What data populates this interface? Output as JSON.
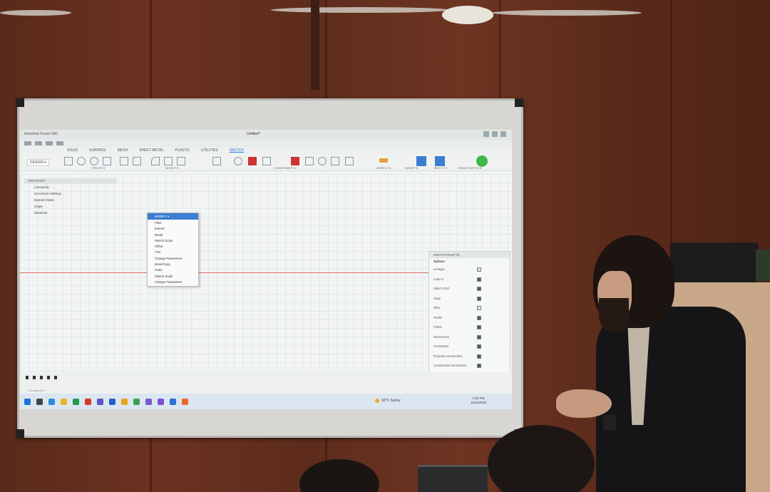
{
  "scene": {
    "description_tag": "classroom-presentation",
    "whiteboard_projection": {
      "app_title": "Autodesk Fusion 360",
      "document_title": "Untitled*",
      "ribbon_tabs": [
        "SOLID",
        "SURFACE",
        "MESH",
        "SHEET METAL",
        "PLASTIC",
        "UTILITIES",
        "SKETCH"
      ],
      "active_tab": "SKETCH",
      "design_dropdown": "DESIGN ▾",
      "groups": [
        "CREATE ▾",
        "MODIFY ▾",
        "CONSTRAINTS ▾",
        "INSPECT ▾",
        "INSERT ▾",
        "SELECT ▾",
        "FINISH SKETCH ▾"
      ],
      "browser": {
        "header": "BROWSER",
        "items": [
          "(Unsaved)",
          "Document Settings",
          "Named Views",
          "Origin",
          "Sketches"
        ]
      },
      "context_menu": {
        "title": "MODIFY ▾",
        "items": [
          "Fillet",
          "Extend",
          "Break",
          "Sketch Scale",
          "Offset",
          "Trim",
          "Change Parameters",
          "Move/Copy",
          "Scale",
          "Sketch Scale",
          "Change Parameters"
        ]
      },
      "sketch_palette": {
        "header": "SKETCH PALETTE",
        "section": "Options",
        "options": [
          {
            "label": "Linetype",
            "on": false
          },
          {
            "label": "Look At",
            "on": true
          },
          {
            "label": "Sketch Grid",
            "on": true
          },
          {
            "label": "Snap",
            "on": true
          },
          {
            "label": "Slice",
            "on": false
          },
          {
            "label": "Profile",
            "on": true
          },
          {
            "label": "Points",
            "on": true
          },
          {
            "label": "Dimensions",
            "on": true
          },
          {
            "label": "Constraints",
            "on": true
          },
          {
            "label": "Projected Geometries",
            "on": true
          },
          {
            "label": "Construction Geometries",
            "on": true
          },
          {
            "label": "3D Sketch",
            "on": false
          }
        ],
        "finish_button": "Finish Sketch"
      },
      "status_text": "1 Component",
      "taskbar": {
        "weather": "32°C Sunny",
        "time": "3:52 PM",
        "date": "10/21/2023"
      }
    }
  }
}
